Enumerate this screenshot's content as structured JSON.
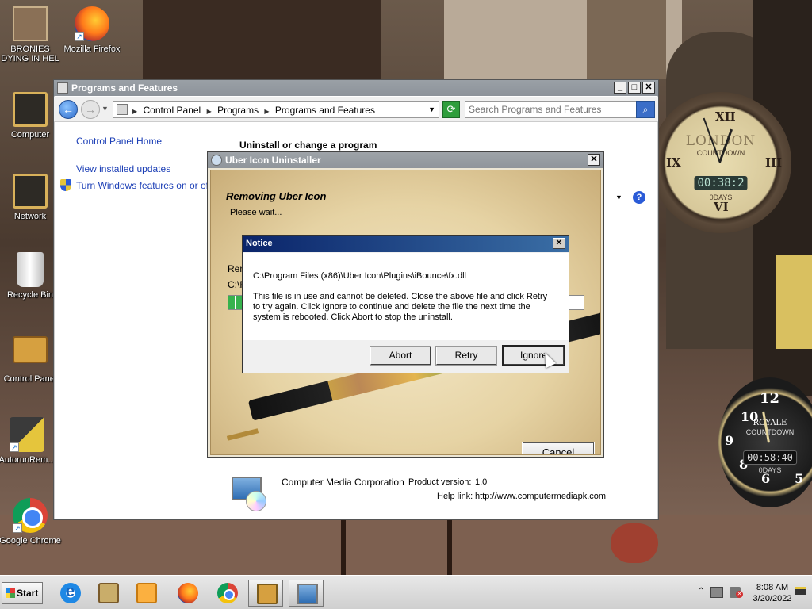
{
  "desktop": {
    "icons": [
      {
        "label": "BRONIES DYING IN HEL",
        "icon": "folder-photo-icon"
      },
      {
        "label": "Mozilla Firefox",
        "icon": "firefox-icon"
      },
      {
        "label": "Computer",
        "icon": "computer-icon"
      },
      {
        "label": "Network",
        "icon": "network-icon"
      },
      {
        "label": "Recycle Bin",
        "icon": "recycle-bin-icon"
      },
      {
        "label": "Control Panel",
        "icon": "control-panel-icon"
      },
      {
        "label": "AutorunRem...",
        "icon": "autorun-remover-icon"
      },
      {
        "label": "Google Chrome",
        "icon": "chrome-icon"
      }
    ]
  },
  "gadgets": {
    "london": {
      "title": "LONDON",
      "sub": "COUNTDOWN",
      "digits": "00:38:2",
      "days": "0DAYS"
    },
    "royale": {
      "title": "ROYALE",
      "sub": "COUNTDOWN",
      "digits": "00:58:40",
      "days": "0DAYS"
    }
  },
  "programs_window": {
    "title": "Programs and Features",
    "breadcrumbs": [
      "Control Panel",
      "Programs",
      "Programs and Features"
    ],
    "search_placeholder": "Search Programs and Features",
    "left_links": [
      "Control Panel Home",
      "View installed updates",
      "Turn Windows features on or off"
    ],
    "heading": "Uninstall or change a program",
    "details": {
      "publisher": "Computer Media Corporation",
      "product_version_label": "Product version:",
      "product_version": "1.0",
      "help_link_label": "Help link:",
      "help_link": "http://www.computermediapk.com"
    }
  },
  "uber_dialog": {
    "title": "Uber Icon Uninstaller",
    "heading": "Removing Uber Icon",
    "sub": "Please wait...",
    "removing_label": "Rem",
    "path_label": "C:\\F",
    "progress": 0.06,
    "cancel_label": "Cancel"
  },
  "notice": {
    "title": "Notice",
    "path": "C:\\Program Files (x86)\\Uber Icon\\Plugins\\iBounce\\fx.dll",
    "message": "This file is in use and cannot be deleted. Close the above file and click Retry to try again. Click Ignore to continue and delete the file the next time the system is rebooted. Click Abort to stop the uninstall.",
    "buttons": {
      "abort": "Abort",
      "retry": "Retry",
      "ignore": "Ignore"
    }
  },
  "taskbar": {
    "start_label": "Start",
    "time": "8:08 AM",
    "date": "3/20/2022"
  }
}
